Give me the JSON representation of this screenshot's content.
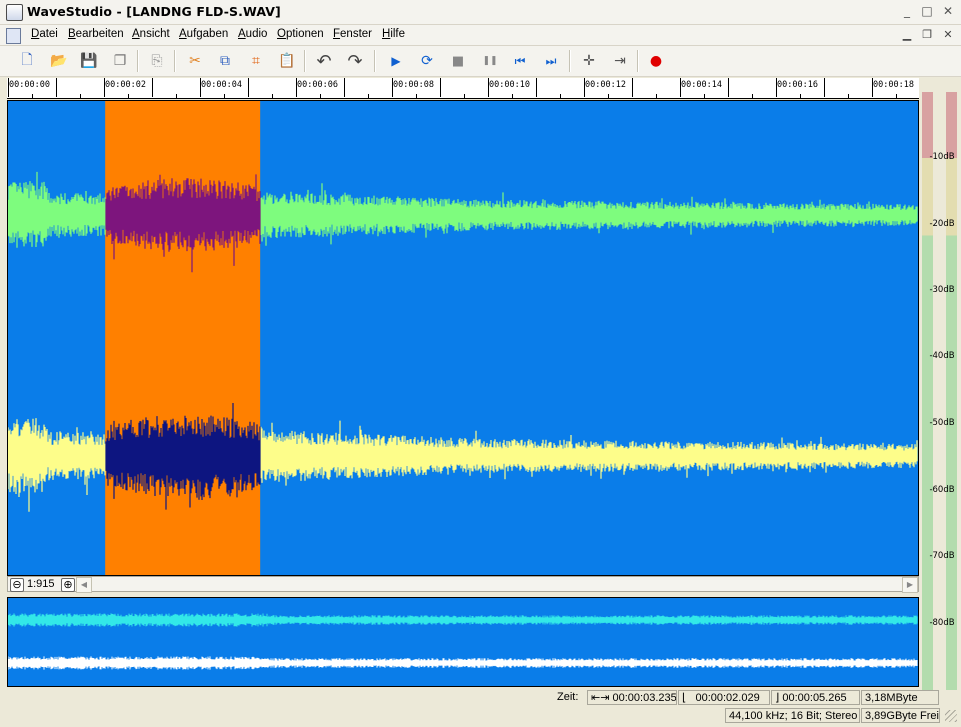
{
  "window": {
    "title": "WaveStudio - [LANDNG FLD-S.WAV]",
    "minimize_glyph": "_",
    "maximize_glyph": "□",
    "close_glyph": "✕"
  },
  "menu": {
    "items": [
      {
        "label": "Datei"
      },
      {
        "label": "Bearbeiten"
      },
      {
        "label": "Ansicht"
      },
      {
        "label": "Aufgaben"
      },
      {
        "label": "Audio"
      },
      {
        "label": "Optionen"
      },
      {
        "label": "Fenster"
      },
      {
        "label": "Hilfe"
      }
    ]
  },
  "toolbar": {
    "buttons": [
      {
        "name": "new-file-icon",
        "glyph": "🗋"
      },
      {
        "name": "open-folder-icon",
        "glyph": "📂"
      },
      {
        "name": "save-icon",
        "glyph": "💾"
      },
      {
        "name": "save-all-icon",
        "glyph": "❐"
      },
      {
        "name": "paste-mix-icon",
        "glyph": "⎘"
      },
      {
        "name": "cut-icon",
        "glyph": "✂"
      },
      {
        "name": "copy-icon",
        "glyph": "⧉"
      },
      {
        "name": "crop-icon",
        "glyph": "⌗"
      },
      {
        "name": "paste-icon",
        "glyph": "📋"
      },
      {
        "name": "undo-icon",
        "glyph": "↶"
      },
      {
        "name": "redo-icon",
        "glyph": "↷"
      },
      {
        "name": "play-icon",
        "glyph": "▶"
      },
      {
        "name": "play-loop-icon",
        "glyph": "⟳"
      },
      {
        "name": "stop-icon",
        "glyph": "■"
      },
      {
        "name": "pause-icon",
        "glyph": "❚❚"
      },
      {
        "name": "skip-start-icon",
        "glyph": "⏮"
      },
      {
        "name": "skip-end-icon",
        "glyph": "⏭"
      },
      {
        "name": "insert-marker-icon",
        "glyph": "✛"
      },
      {
        "name": "goto-marker-icon",
        "glyph": "⇥"
      },
      {
        "name": "record-icon",
        "glyph": "●"
      }
    ]
  },
  "ruler": {
    "labels": [
      "00:00:00",
      "00:00:02",
      "00:00:04",
      "00:00:06",
      "00:00:08",
      "00:00:10",
      "00:00:12",
      "00:00:14",
      "00:00:16",
      "00:00:18"
    ]
  },
  "waveform": {
    "background_color": "#0a7de9",
    "left_channel_color": "#7efc7e",
    "right_channel_color": "#fdfd8a",
    "selection_color": "#ff8000",
    "selected_left_color": "#7d157d",
    "selected_right_color": "#0d1580",
    "overview_left_color": "#32e8e8",
    "overview_right_color": "#ffffff",
    "selection_start_s": 2.029,
    "selection_end_s": 5.265,
    "visible_duration_s": 19.0
  },
  "zoom": {
    "value": "1:915",
    "zoom_out_glyph": "⊖",
    "zoom_in_glyph": "⊕"
  },
  "meter": {
    "labels": [
      "-10dB",
      "-20dB",
      "-30dB",
      "-40dB",
      "-50dB",
      "-60dB",
      "-70dB",
      "-80dB"
    ],
    "colors": {
      "red": "#d8a1a1",
      "yellow": "#e3ddb0",
      "green": "#b3dcad"
    }
  },
  "status": {
    "zeit_label": "Zeit:",
    "cursor_time": "00:00:03.235",
    "selection_start": "00:00:02.029",
    "selection_end": "00:00:05.265",
    "file_size": "3,18MByte",
    "format": "44,100 kHz; 16 Bit; Stereo",
    "free_space": "3,89GByte Frei"
  }
}
